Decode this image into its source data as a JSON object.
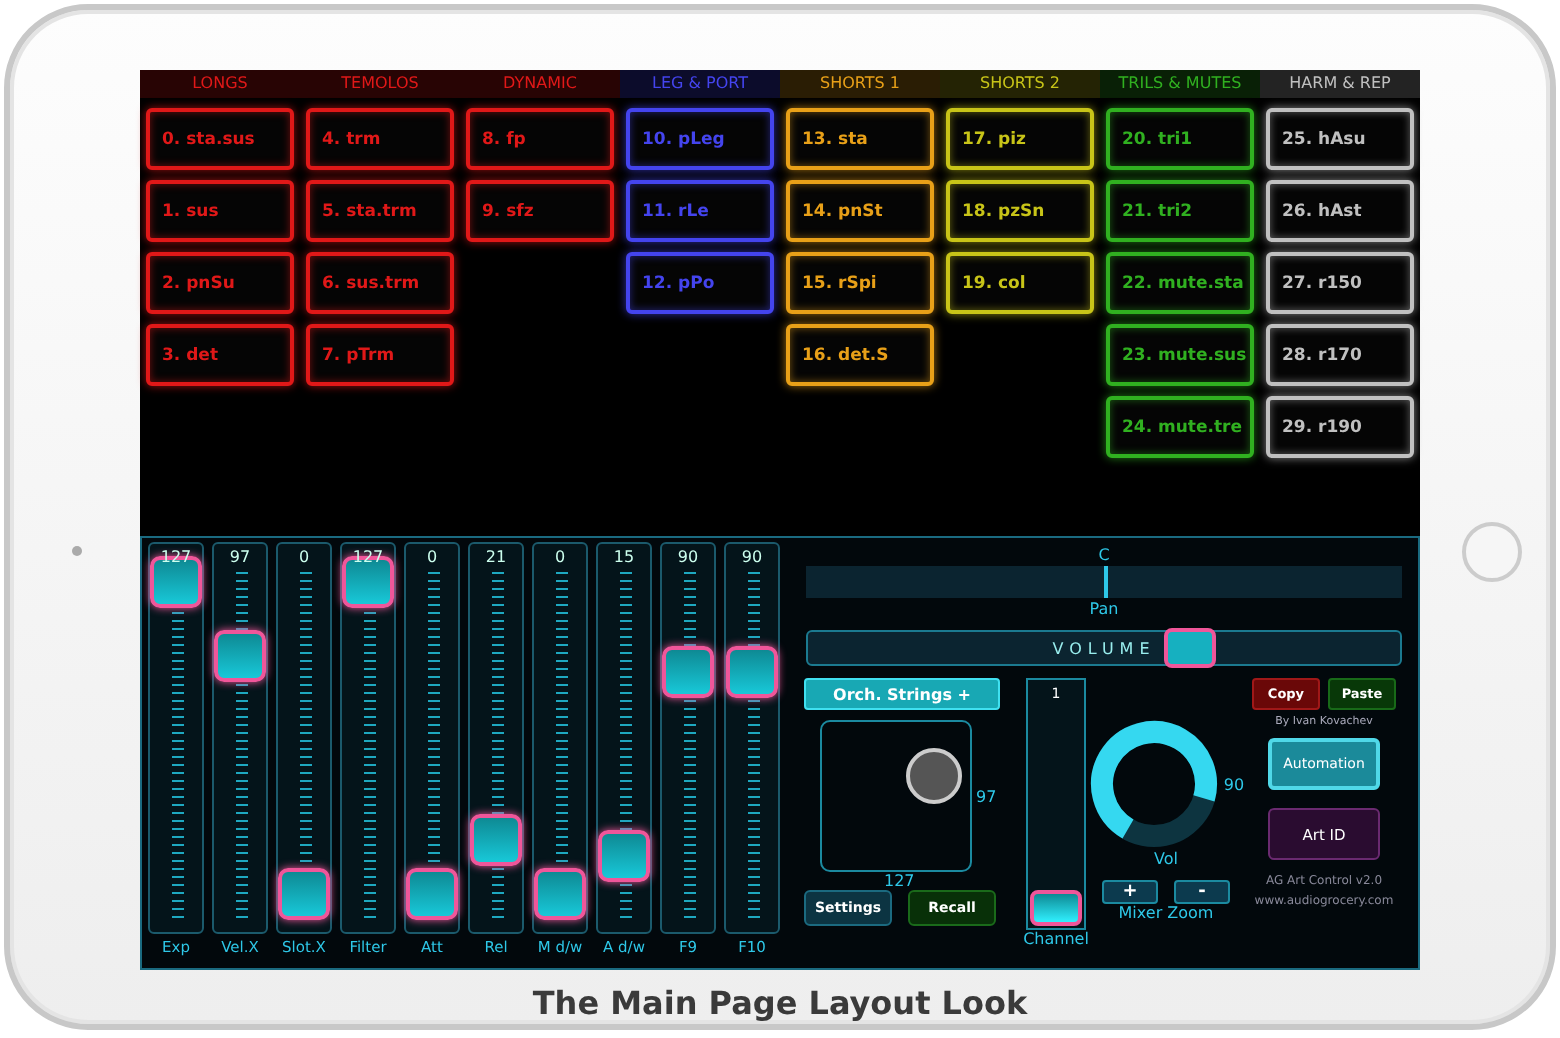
{
  "columns": [
    {
      "title": "LONGS",
      "color": "#e01818",
      "items": [
        "0. sta.sus",
        "1. sus",
        "2. pnSu",
        "3. det"
      ]
    },
    {
      "title": "TEMOLOS",
      "color": "#e01818",
      "items": [
        "4. trm",
        "5. sta.trm",
        "6. sus.trm",
        "7. pTrm"
      ]
    },
    {
      "title": "DYNAMIC",
      "color": "#e01818",
      "items": [
        "8. fp",
        "9. sfz"
      ]
    },
    {
      "title": "LEG & PORT",
      "color": "#4444ee",
      "items": [
        "10. pLeg",
        "11. rLe",
        "12. pPo"
      ]
    },
    {
      "title": "SHORTS 1",
      "color": "#e8a018",
      "items": [
        "13. sta",
        "14. pnSt",
        "15. rSpi",
        "16. det.S"
      ]
    },
    {
      "title": "SHORTS 2",
      "color": "#c8c418",
      "items": [
        "17. piz",
        "18. pzSn",
        "19. col"
      ]
    },
    {
      "title": "TRILS & MUTES",
      "color": "#30b020",
      "items": [
        "20. tri1",
        "21. tri2",
        "22. mute.sta",
        "23. mute.sus",
        "24. mute.tre"
      ]
    },
    {
      "title": "HARM & REP",
      "color": "#c0c0c0",
      "items": [
        "25. hAsu",
        "26. hAst",
        "27. r150",
        "28. r170",
        "29. r190"
      ]
    }
  ],
  "faders": [
    {
      "label": "Exp",
      "value": "127",
      "level": 1
    },
    {
      "label": "Vel.X",
      "value": "97",
      "level": 0.76
    },
    {
      "label": "Slot.X",
      "value": "0",
      "level": 0
    },
    {
      "label": "Filter",
      "value": "127",
      "level": 1
    },
    {
      "label": "Att",
      "value": "0",
      "level": 0
    },
    {
      "label": "Rel",
      "value": "21",
      "level": 0.17
    },
    {
      "label": "M d/w",
      "value": "0",
      "level": 0
    },
    {
      "label": "A d/w",
      "value": "15",
      "level": 0.12
    },
    {
      "label": "F9",
      "value": "90",
      "level": 0.71
    },
    {
      "label": "F10",
      "value": "90",
      "level": 0.71
    }
  ],
  "pan": {
    "top_label": "C",
    "label": "Pan",
    "level": 0.5
  },
  "volume": {
    "label": "VOLUME",
    "level": 0.66
  },
  "preset_button": "Orch. Strings +",
  "xy_pad": {
    "y_reading": "97",
    "x_reading": "127"
  },
  "buttons_left": [
    "Settings",
    "Recall"
  ],
  "channel": {
    "value": "1",
    "label": "Channel",
    "level": 0
  },
  "vol_knob": {
    "label": "Vol",
    "reading": "90",
    "level": 0.71
  },
  "zoom_buttons": [
    "+",
    "-"
  ],
  "zoom_label": "Mixer Zoom",
  "copy_button": "Copy",
  "paste_button": "Paste",
  "author": "By Ivan Kovachev",
  "automation_button": "Automation",
  "art_id_button": "Art ID",
  "version": "AG Art Control v2.0",
  "website": "www.audiogrocery.com",
  "caption": "The Main Page Layout Look"
}
